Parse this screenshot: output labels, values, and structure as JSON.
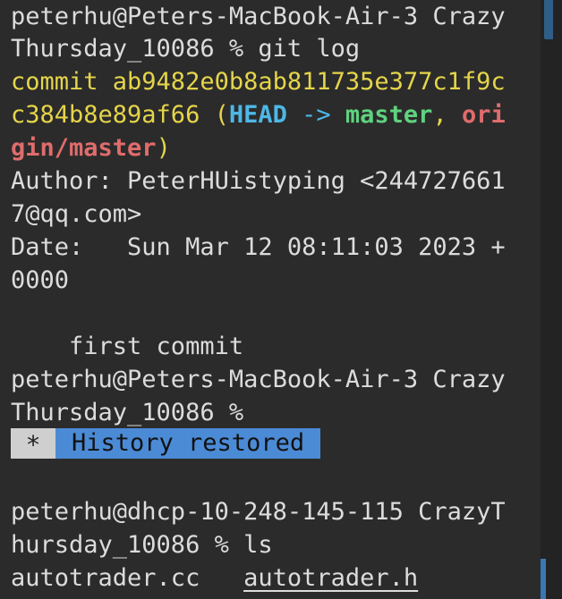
{
  "terminal": {
    "lines": [
      "peterhu@Peters-MacBook-Air-3 Crazy",
      "Thursday_10086 % git log",
      "commit ab9482e0b8ab811735e377c1f9c",
      "c384b8e89af66",
      "Author: PeterHUistyping <244727661",
      "7@qq.com>",
      "Date:   Sun Mar 12 08:11:03 2023 +",
      "0000",
      "    first commit",
      "peterhu@Peters-MacBook-Air-3 Crazy",
      "Thursday_10086 %",
      "peterhu@dhcp-10-248-145-115 CrazyT",
      "hursday_10086 % ls",
      "autotrader.cc   ",
      "autotrader.h"
    ],
    "refs": {
      "open_paren": " (",
      "head": "HEAD",
      "arrow": " -> ",
      "master": "master",
      "comma": ", ",
      "origin_part1": "ori",
      "origin_part2": "gin/master",
      "close_paren": ")"
    },
    "history_badge": {
      "star": "*",
      "label": "History restored"
    }
  },
  "colors": {
    "background": "#2b2b2b",
    "text": "#dcdcdc",
    "commit_yellow": "#e5d54a",
    "head_blue": "#4eb7e6",
    "branch_green": "#5fd27f",
    "remote_red": "#e06c6c",
    "badge_blue": "#4b8bd6"
  }
}
